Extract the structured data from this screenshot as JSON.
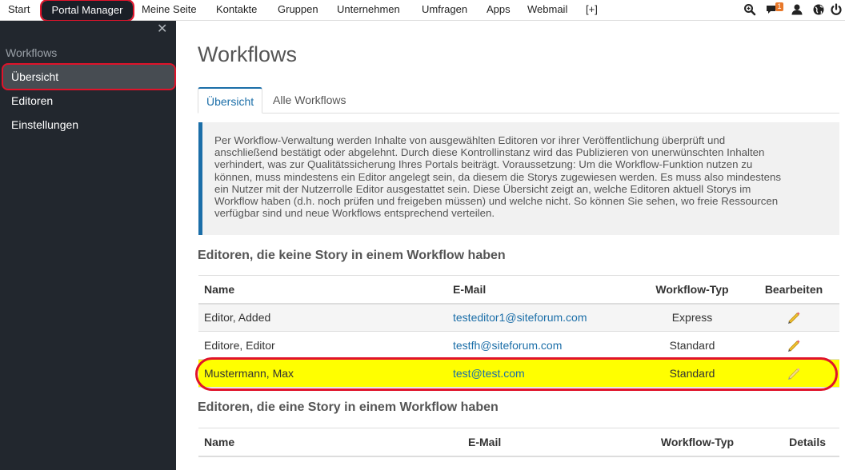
{
  "nav": {
    "items": [
      {
        "label": "Start"
      },
      {
        "label": "Portal Manager"
      },
      {
        "label": "Meine Seite"
      },
      {
        "label": "Kontakte"
      },
      {
        "label": "Gruppen"
      },
      {
        "label": "Unternehmen"
      },
      {
        "label": "Umfragen"
      },
      {
        "label": "Apps"
      },
      {
        "label": "Webmail"
      },
      {
        "label": "[+]"
      }
    ],
    "notification_count": "1",
    "icons": [
      "search-icon",
      "chat-icon",
      "user-icon",
      "globe-icon",
      "power-icon"
    ]
  },
  "sidebar": {
    "heading": "Workflows",
    "items": [
      {
        "label": "Übersicht"
      },
      {
        "label": "Editoren"
      },
      {
        "label": "Einstellungen"
      }
    ]
  },
  "main": {
    "title": "Workflows",
    "tabs": [
      {
        "label": "Übersicht"
      },
      {
        "label": "Alle Workflows"
      }
    ],
    "info_lines": [
      "Per Workflow-Verwaltung werden Inhalte von ausgewählten Editoren vor ihrer Veröffentlichung überprüft und",
      "anschließend bestätigt oder abgelehnt. Durch diese Kontrollinstanz wird das Publizieren von unerwünschten Inhalten",
      "verhindert, was zur Qualitätssicherung Ihres Portals beiträgt. Voraussetzung: Um die Workflow-Funktion nutzen zu",
      "können, muss mindestens ein Editor angelegt sein, da diesem die Storys zugewiesen werden. Es muss also mindestens",
      "ein Nutzer mit der Nutzerrolle Editor ausgestattet sein. Diese Übersicht zeigt an, welche Editoren aktuell Storys im",
      "Workflow haben (d.h. noch prüfen und freigeben müssen) und welche nicht. So können Sie sehen, wo freie Ressourcen",
      "verfügbar sind und neue Workflows entsprechend verteilen."
    ],
    "section1": {
      "title": "Editoren, die keine Story in einem Workflow haben",
      "headers": {
        "name": "Name",
        "email": "E-Mail",
        "type": "Workflow-Typ",
        "action": "Bearbeiten"
      },
      "rows": [
        {
          "name": "Editor, Added",
          "email": "testeditor1@siteforum.com",
          "type": "Express"
        },
        {
          "name": "Editore, Editor",
          "email": "testfh@siteforum.com",
          "type": "Standard"
        },
        {
          "name": "Mustermann, Max",
          "email": "test@test.com",
          "type": "Standard"
        }
      ]
    },
    "section2": {
      "title": "Editoren, die eine Story in einem Workflow haben",
      "headers": {
        "name": "Name",
        "email": "E-Mail",
        "type": "Workflow-Typ",
        "action": "Details"
      }
    }
  },
  "colors": {
    "accent": "#1b6ea8",
    "sidebar_bg": "#22272e",
    "highlight_row": "#ffff00",
    "annotation_red": "#e0132a"
  }
}
